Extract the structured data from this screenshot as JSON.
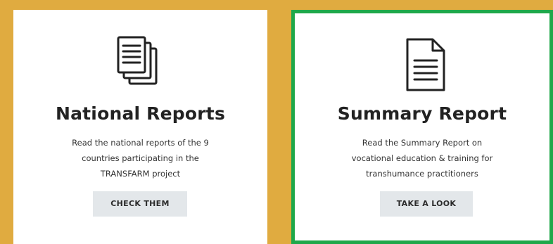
{
  "cards": [
    {
      "icon": "stacked-documents-icon",
      "title": "National Reports",
      "desc_lines": [
        "Read the national reports of the 9",
        "countries participating in the",
        "TRANSFARM project"
      ],
      "button_label": "CHECK THEM"
    },
    {
      "icon": "document-icon",
      "title": "Summary Report",
      "desc_lines": [
        "Read the Summary Report on",
        "vocational education & training for",
        "transhumance practitioners"
      ],
      "button_label": "TAKE A LOOK"
    }
  ],
  "colors": {
    "background": "#E0AB40",
    "card": "#ffffff",
    "selected_border": "#1FA84A",
    "button": "#E3E7EA"
  }
}
